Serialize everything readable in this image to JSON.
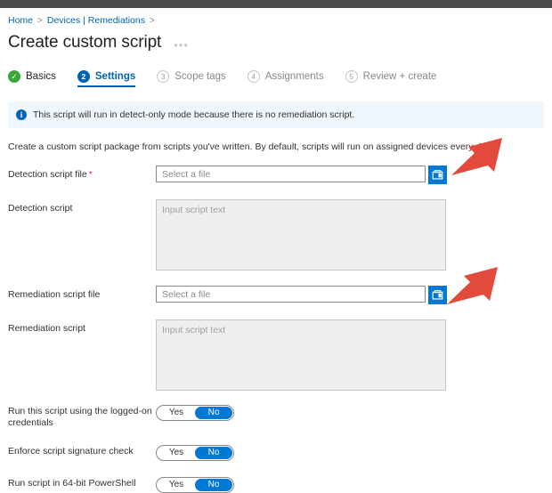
{
  "window": {
    "topbar_color": "#4a4a48"
  },
  "breadcrumb": {
    "items": [
      {
        "label": "Home",
        "link": true
      },
      {
        "label": "Devices | Remediations",
        "link": true
      }
    ],
    "separator": ">"
  },
  "header": {
    "title": "Create custom script",
    "more_label": "•••"
  },
  "wizard": {
    "tabs": [
      {
        "label": "Basics",
        "state": "done",
        "badge": "✓"
      },
      {
        "label": "Settings",
        "state": "active",
        "badge": "2"
      },
      {
        "label": "Scope tags",
        "state": "pending",
        "badge": "3"
      },
      {
        "label": "Assignments",
        "state": "pending",
        "badge": "4"
      },
      {
        "label": "Review + create",
        "state": "pending",
        "badge": "5"
      }
    ],
    "active_color": "#0063b1",
    "done_color": "#3aa73a"
  },
  "banner": {
    "icon": "info-icon",
    "text": "This script will run in detect-only mode because there is no remediation script.",
    "background": "#eff6fc"
  },
  "description": "Create a custom script package from scripts you've written. By default, scripts will run on assigned devices every day.",
  "form": {
    "detection_file": {
      "label": "Detection script file",
      "required": true,
      "required_marker": "*",
      "value": "",
      "placeholder": "Select a file",
      "browse_icon": "folder-browse-icon"
    },
    "detection_script": {
      "label": "Detection script",
      "value": "",
      "placeholder": "Input script text"
    },
    "remediation_file": {
      "label": "Remediation script file",
      "required": false,
      "value": "",
      "placeholder": "Select a file",
      "browse_icon": "folder-browse-icon"
    },
    "remediation_script": {
      "label": "Remediation script",
      "value": "",
      "placeholder": "Input script text"
    }
  },
  "toggles": [
    {
      "label": "Run this script using the logged-on credentials",
      "yes_label": "Yes",
      "no_label": "No",
      "selected": "No"
    },
    {
      "label": "Enforce script signature check",
      "yes_label": "Yes",
      "no_label": "No",
      "selected": "No"
    },
    {
      "label": "Run script in 64-bit PowerShell",
      "yes_label": "Yes",
      "no_label": "No",
      "selected": "No"
    }
  ],
  "annotations": {
    "arrow_color": "#e24b3c",
    "arrows": [
      {
        "name": "arrow-to-detection-browse"
      },
      {
        "name": "arrow-to-remediation-browse"
      }
    ]
  }
}
